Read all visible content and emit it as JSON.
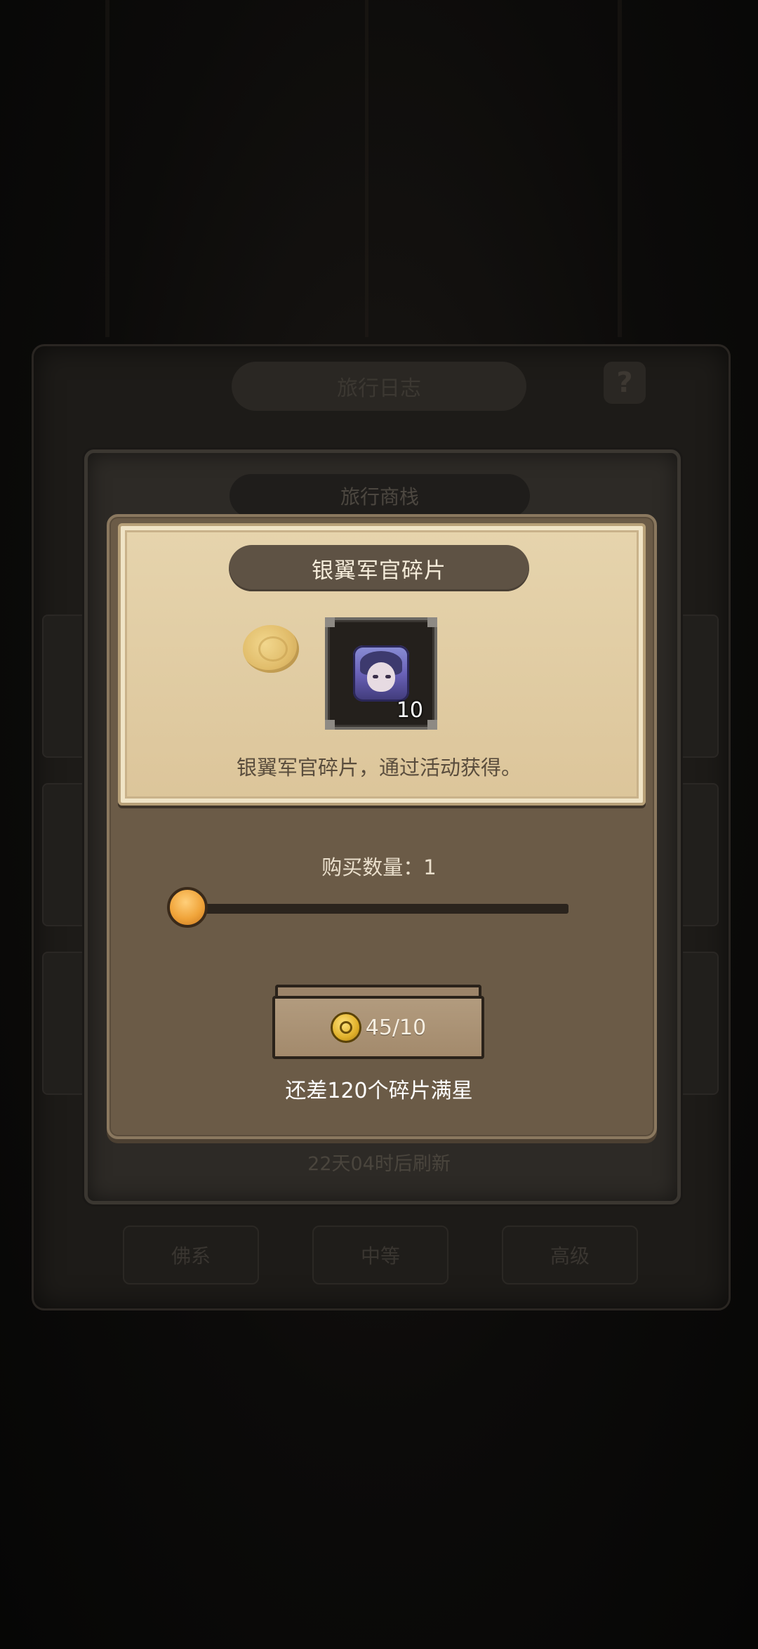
{
  "background": {
    "travel_log_title": "旅行日志",
    "help_icon": "question-mark-icon",
    "tabs": [
      "佛系",
      "中等",
      "高级"
    ]
  },
  "shop": {
    "title": "旅行商栈",
    "refresh_text": "22天04时后刷新"
  },
  "dialog": {
    "item_name": "银翼军官碎片",
    "item_count": "10",
    "item_description": "银翼军官碎片，通过活动获得。",
    "quantity_label": "购买数量：1",
    "quantity": 1,
    "quantity_fill_fraction": 0.0,
    "price_icon": "medal-coin-icon",
    "price_text": "45/10",
    "shards_remaining_text": "还差120个碎片满星"
  },
  "colors": {
    "accent_orange": "#f0a43a",
    "parchment": "#e6d4ad",
    "dialog_brown": "#6b5b47"
  }
}
